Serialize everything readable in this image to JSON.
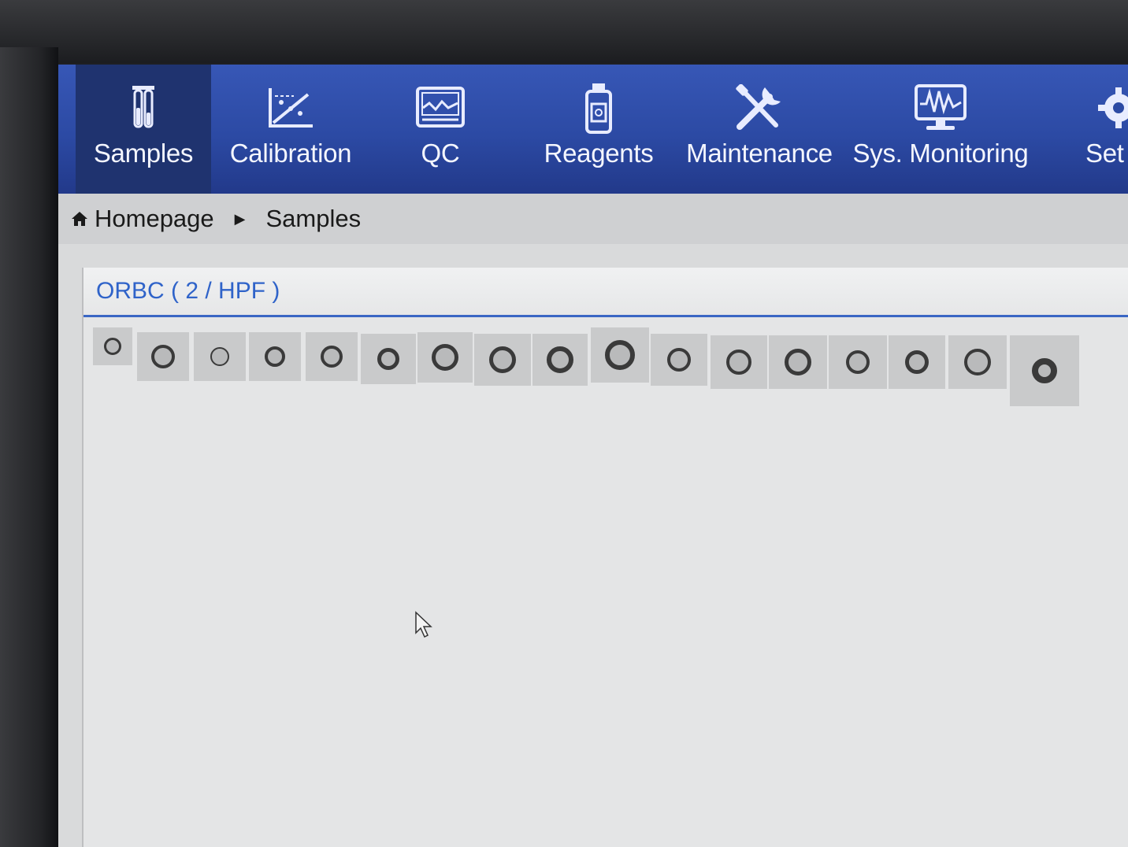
{
  "nav": {
    "items": [
      {
        "label": "Samples",
        "icon": "sample-tubes-icon",
        "active": true
      },
      {
        "label": "Calibration",
        "icon": "calibration-chart-icon",
        "active": false
      },
      {
        "label": "QC",
        "icon": "qc-monitor-icon",
        "active": false
      },
      {
        "label": "Reagents",
        "icon": "reagent-bottle-icon",
        "active": false
      },
      {
        "label": "Maintenance",
        "icon": "tools-icon",
        "active": false
      },
      {
        "label": "Sys. Monitoring",
        "icon": "monitor-waveform-icon",
        "active": false
      },
      {
        "label": "Set",
        "icon": "gear-icon",
        "active": false
      }
    ],
    "bar_color": "#2c4aa4",
    "active_color": "#1f336f"
  },
  "breadcrumb": {
    "home_label": "Homepage",
    "current_label": "Samples",
    "home_icon": "home-icon",
    "separator_icon": "triangle-right-icon"
  },
  "panel": {
    "title": "ORBC ( 2 / HPF )",
    "title_color": "#2f63c9",
    "cell_image_count": 17
  }
}
